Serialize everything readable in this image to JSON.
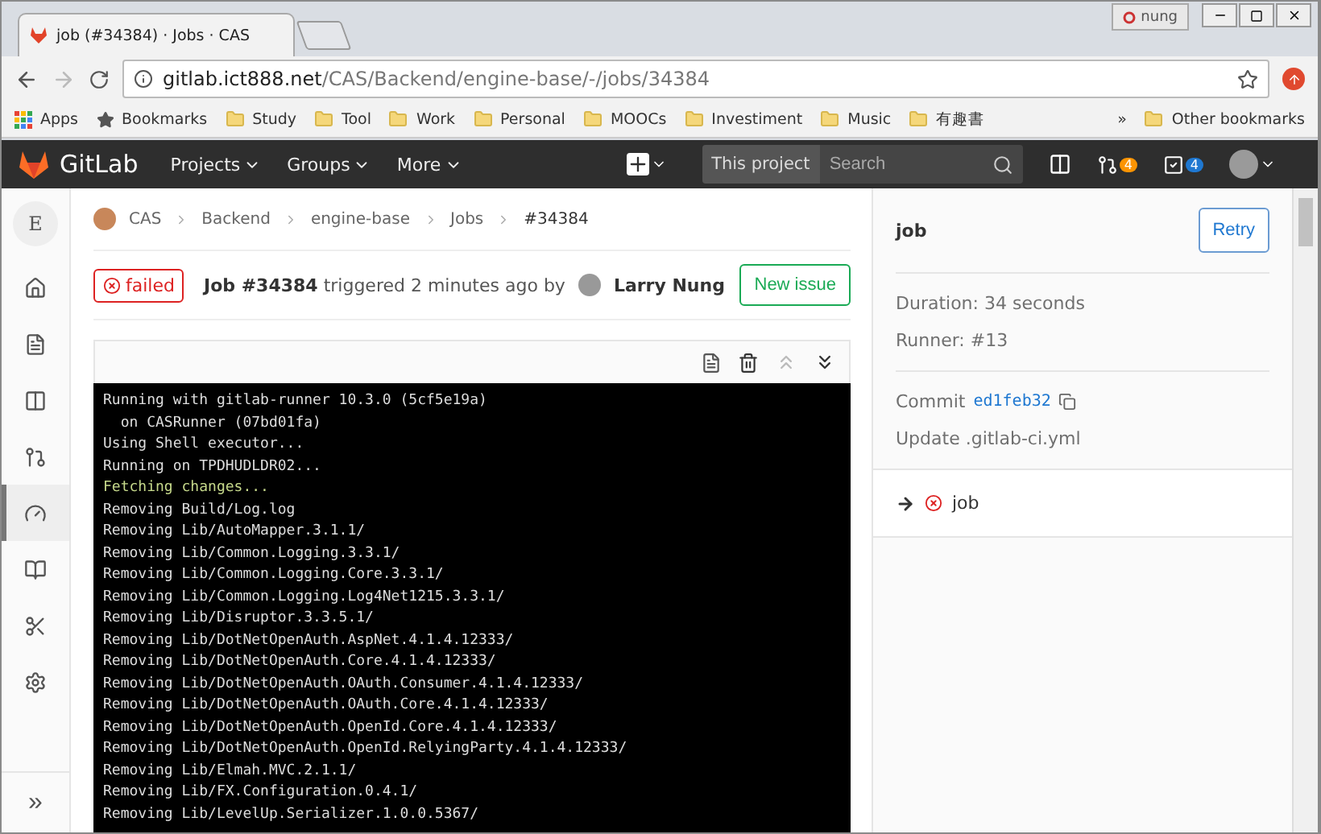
{
  "browser": {
    "tab_title": "job (#34384) · Jobs · CAS",
    "user": "nung",
    "url_host": "gitlab.ict888.net",
    "url_path": "/CAS/Backend/engine-base/-/jobs/34384",
    "bookmarks": [
      {
        "label": "Apps",
        "kind": "apps"
      },
      {
        "label": "Bookmarks",
        "kind": "star"
      },
      {
        "label": "Study",
        "kind": "folder"
      },
      {
        "label": "Tool",
        "kind": "folder"
      },
      {
        "label": "Work",
        "kind": "folder"
      },
      {
        "label": "Personal",
        "kind": "folder"
      },
      {
        "label": "MOOCs",
        "kind": "folder"
      },
      {
        "label": "Investiment",
        "kind": "folder"
      },
      {
        "label": "Music",
        "kind": "folder"
      },
      {
        "label": "有趣書",
        "kind": "folder"
      }
    ],
    "more": "»",
    "other_bookmarks": "Other bookmarks"
  },
  "navbar": {
    "brand": "GitLab",
    "menus": [
      "Projects",
      "Groups",
      "More"
    ],
    "scope": "This project",
    "search_placeholder": "Search",
    "merge_requests_count": "4",
    "todos_count": "4"
  },
  "sidebar": {
    "avatar_letter": "E",
    "items": [
      {
        "kind": "home",
        "selected": false
      },
      {
        "kind": "repository",
        "selected": false
      },
      {
        "kind": "board",
        "selected": false
      },
      {
        "kind": "merge",
        "selected": false
      },
      {
        "kind": "pipeline",
        "selected": true
      },
      {
        "kind": "wiki",
        "selected": false
      },
      {
        "kind": "snippet",
        "selected": false
      },
      {
        "kind": "settings",
        "selected": false
      }
    ],
    "collapse": "»"
  },
  "breadcrumbs": [
    "CAS",
    "Backend",
    "engine-base",
    "Jobs",
    "#34384"
  ],
  "job_header": {
    "status": "failed",
    "summary": "**Job #34384** triggered 2 minutes ago by",
    "user": "Larry Nung",
    "new_issue": "New issue"
  },
  "log": {
    "lines": [
      {
        "text": "Running with gitlab-runner 10.3.0 (5cf5e19a)",
        "kind": "normal"
      },
      {
        "text": "  on CASRunner (07bd01fa)",
        "kind": "normal"
      },
      {
        "text": "Using Shell executor...",
        "kind": "normal"
      },
      {
        "text": "Running on TPDHUDLDR02...",
        "kind": "normal"
      },
      {
        "text": "Fetching changes...",
        "kind": "section"
      },
      {
        "text": "Removing Build/Log.log",
        "kind": "normal"
      },
      {
        "text": "Removing Lib/AutoMapper.3.1.1/",
        "kind": "normal"
      },
      {
        "text": "Removing Lib/Common.Logging.3.3.1/",
        "kind": "normal"
      },
      {
        "text": "Removing Lib/Common.Logging.Core.3.3.1/",
        "kind": "normal"
      },
      {
        "text": "Removing Lib/Common.Logging.Log4Net1215.3.3.1/",
        "kind": "normal"
      },
      {
        "text": "Removing Lib/Disruptor.3.3.5.1/",
        "kind": "normal"
      },
      {
        "text": "Removing Lib/DotNetOpenAuth.AspNet.4.1.4.12333/",
        "kind": "normal"
      },
      {
        "text": "Removing Lib/DotNetOpenAuth.Core.4.1.4.12333/",
        "kind": "normal"
      },
      {
        "text": "Removing Lib/DotNetOpenAuth.OAuth.Consumer.4.1.4.12333/",
        "kind": "normal"
      },
      {
        "text": "Removing Lib/DotNetOpenAuth.OAuth.Core.4.1.4.12333/",
        "kind": "normal"
      },
      {
        "text": "Removing Lib/DotNetOpenAuth.OpenId.Core.4.1.4.12333/",
        "kind": "normal"
      },
      {
        "text": "Removing Lib/DotNetOpenAuth.OpenId.RelyingParty.4.1.4.12333/",
        "kind": "normal"
      },
      {
        "text": "Removing Lib/Elmah.MVC.2.1.1/",
        "kind": "normal"
      },
      {
        "text": "Removing Lib/FX.Configuration.0.4.1/",
        "kind": "normal"
      },
      {
        "text": "Removing Lib/LevelUp.Serializer.1.0.0.5367/",
        "kind": "normal"
      }
    ]
  },
  "details": {
    "title": "job",
    "retry": "Retry",
    "duration": "Duration: 34 seconds",
    "runner": "Runner: #13",
    "commit_label": "Commit",
    "commit_sha": "ed1feb32",
    "commit_message": "Update .gitlab-ci.yml",
    "jobs": [
      {
        "name": "job",
        "current": true
      }
    ]
  }
}
